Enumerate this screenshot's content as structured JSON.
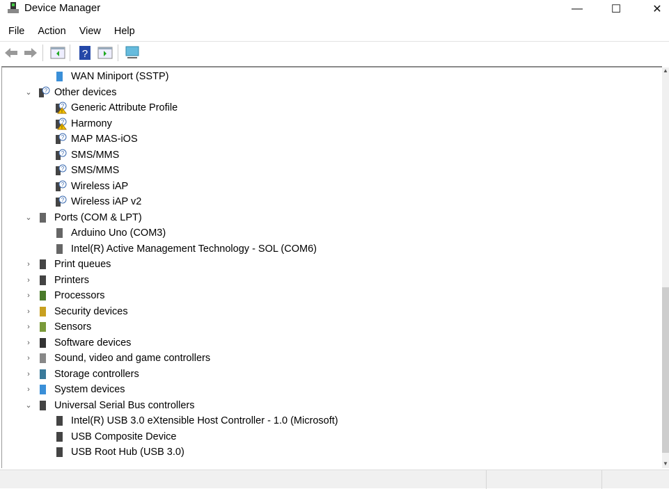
{
  "window": {
    "title": "Device Manager",
    "minimize": "—",
    "maximize": "☐",
    "close": "✕"
  },
  "menu": [
    "File",
    "Action",
    "View",
    "Help"
  ],
  "toolbar": [
    "back-icon",
    "forward-icon",
    "show-hide-console-tree-icon",
    "help-icon",
    "action-pane-icon",
    "scan-hardware-icon"
  ],
  "tree": [
    {
      "label": "WAN Miniport (SSTP)",
      "level": 1,
      "icon": "network-icon"
    },
    {
      "label": "Other devices",
      "level": 0,
      "expanded": true,
      "icon": "unknown-device-icon"
    },
    {
      "label": "Generic Attribute Profile",
      "level": 1,
      "icon": "warning-device-icon"
    },
    {
      "label": "Harmony",
      "level": 1,
      "icon": "warning-device-icon"
    },
    {
      "label": "MAP MAS-iOS",
      "level": 1,
      "icon": "unknown-device-icon"
    },
    {
      "label": "SMS/MMS",
      "level": 1,
      "icon": "unknown-device-icon"
    },
    {
      "label": "SMS/MMS",
      "level": 1,
      "icon": "unknown-device-icon"
    },
    {
      "label": "Wireless iAP",
      "level": 1,
      "icon": "unknown-device-icon"
    },
    {
      "label": "Wireless iAP v2",
      "level": 1,
      "icon": "unknown-device-icon"
    },
    {
      "label": "Ports (COM & LPT)",
      "level": 0,
      "expanded": true,
      "icon": "port-icon"
    },
    {
      "label": "Arduino Uno (COM3)",
      "level": 1,
      "icon": "port-icon"
    },
    {
      "label": "Intel(R) Active Management Technology - SOL (COM6)",
      "level": 1,
      "icon": "port-icon"
    },
    {
      "label": "Print queues",
      "level": 0,
      "expanded": false,
      "icon": "printer-icon"
    },
    {
      "label": "Printers",
      "level": 0,
      "expanded": false,
      "icon": "printer-icon"
    },
    {
      "label": "Processors",
      "level": 0,
      "expanded": false,
      "icon": "processor-icon"
    },
    {
      "label": "Security devices",
      "level": 0,
      "expanded": false,
      "icon": "security-icon"
    },
    {
      "label": "Sensors",
      "level": 0,
      "expanded": false,
      "icon": "sensor-icon"
    },
    {
      "label": "Software devices",
      "level": 0,
      "expanded": false,
      "icon": "software-device-icon"
    },
    {
      "label": "Sound, video and game controllers",
      "level": 0,
      "expanded": false,
      "icon": "speaker-icon"
    },
    {
      "label": "Storage controllers",
      "level": 0,
      "expanded": false,
      "icon": "storage-icon"
    },
    {
      "label": "System devices",
      "level": 0,
      "expanded": false,
      "icon": "system-icon"
    },
    {
      "label": "Universal Serial Bus controllers",
      "level": 0,
      "expanded": true,
      "icon": "usb-icon"
    },
    {
      "label": "Intel(R) USB 3.0 eXtensible Host Controller - 1.0 (Microsoft)",
      "level": 1,
      "icon": "usb-icon"
    },
    {
      "label": "USB Composite Device",
      "level": 1,
      "icon": "usb-icon"
    },
    {
      "label": "USB Root Hub (USB 3.0)",
      "level": 1,
      "icon": "usb-icon"
    }
  ]
}
